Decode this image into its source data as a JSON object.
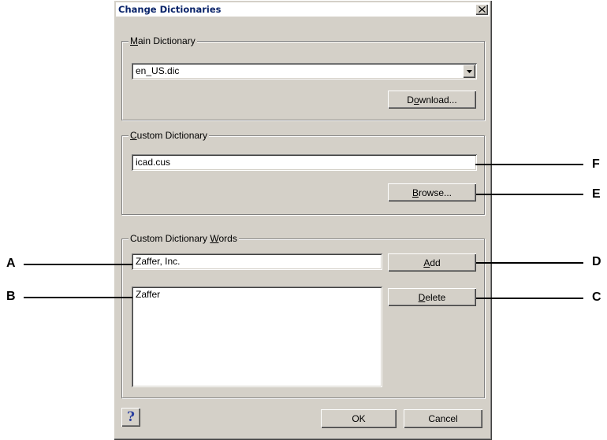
{
  "window": {
    "title": "Change Dictionaries"
  },
  "icons": {
    "close": "close-icon",
    "dropdown": "chevron-down-icon",
    "help": "help-icon"
  },
  "main_dictionary": {
    "label_key": "M",
    "label_rest": "ain Dictionary",
    "selected_value": "en_US.dic",
    "download_key": "o",
    "download_pre": "D",
    "download_post": "wnload..."
  },
  "custom_dictionary": {
    "label_key": "C",
    "label_rest": "ustom Dictionary",
    "value": "icad.cus",
    "browse_key": "B",
    "browse_rest": "rowse..."
  },
  "custom_words": {
    "label_pre": "Custom Dictionary ",
    "label_key": "W",
    "label_post": "ords",
    "input_value": "Zaffer, Inc.",
    "add_key": "A",
    "add_rest": "dd",
    "delete_key": "D",
    "delete_rest": "elete",
    "words": [
      "Zaffer"
    ]
  },
  "footer": {
    "help_glyph": "?",
    "ok_label": "OK",
    "cancel_label": "Cancel"
  },
  "callouts": {
    "a": "A",
    "b": "B",
    "c": "C",
    "d": "D",
    "e": "E",
    "f": "F"
  }
}
